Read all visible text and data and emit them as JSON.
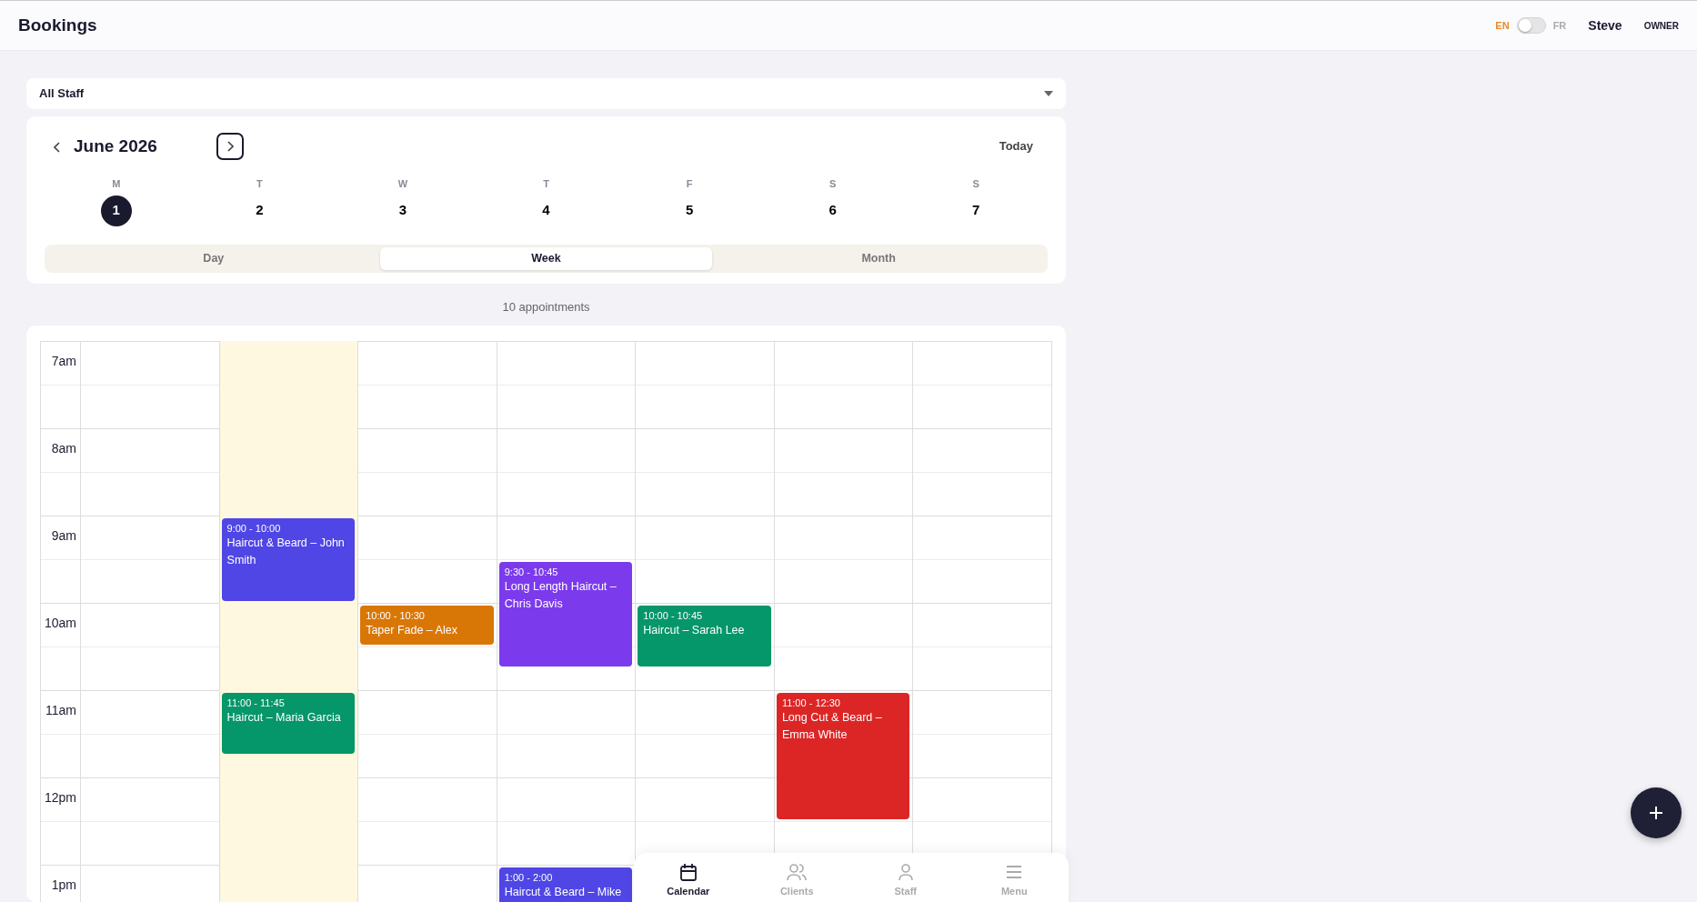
{
  "header": {
    "title": "Bookings",
    "languages": [
      {
        "label": "EN",
        "selected": true
      },
      {
        "label": "FR",
        "selected": false
      }
    ],
    "language_toggle": {
      "on": false
    },
    "user": "Steve",
    "role": "OWNER"
  },
  "staff_filter": {
    "value": "All Staff"
  },
  "calendar": {
    "month": "June 2026",
    "today_button": "Today",
    "days": [
      {
        "weekday": "M",
        "date": "1",
        "selected": true
      },
      {
        "weekday": "T",
        "date": "2",
        "selected": false
      },
      {
        "weekday": "W",
        "date": "3",
        "selected": false
      },
      {
        "weekday": "T",
        "date": "4",
        "selected": false
      },
      {
        "weekday": "F",
        "date": "5",
        "selected": false
      },
      {
        "weekday": "S",
        "date": "6",
        "selected": false
      },
      {
        "weekday": "S",
        "date": "7",
        "selected": false
      }
    ],
    "views": [
      {
        "label": "Day",
        "selected": false
      },
      {
        "label": "Week",
        "selected": true
      },
      {
        "label": "Month",
        "selected": false
      }
    ]
  },
  "appointment_count": "10 appointments",
  "schedule": {
    "hours": [
      "7am",
      "8am",
      "9am",
      "10am",
      "11am",
      "12pm",
      "1pm"
    ],
    "columns": [
      {
        "highlighted": false
      },
      {
        "highlighted": true,
        "events": [
          {
            "time": "9:00 - 10:00",
            "title": "Haircut & Beard – John Smith",
            "color": "#4f46e5"
          },
          {
            "time": "11:00 - 11:45",
            "title": "Haircut – Maria Garcia",
            "color": "#059669"
          }
        ]
      },
      {
        "highlighted": false,
        "events": [
          {
            "time": "10:00 - 10:30",
            "title": "Taper Fade – Alex",
            "color": "#d97706"
          }
        ]
      },
      {
        "highlighted": false,
        "events": [
          {
            "time": "9:30 - 10:45",
            "title": "Long Length Haircut – Chris Davis",
            "color": "#7c3aed"
          },
          {
            "time": "1:00 - 2:00",
            "title": "Haircut & Beard – Mike",
            "color": "#4f46e5"
          }
        ]
      },
      {
        "highlighted": false,
        "events": [
          {
            "time": "10:00 - 10:45",
            "title": "Haircut – Sarah Lee",
            "color": "#059669"
          }
        ]
      },
      {
        "highlighted": false,
        "events": [
          {
            "time": "11:00 - 12:30",
            "title": "Long Cut & Beard – Emma White",
            "color": "#dc2626"
          }
        ]
      },
      {
        "highlighted": false
      }
    ]
  },
  "bottom_nav": [
    {
      "kind": "calendar",
      "label": "Calendar",
      "selected": true
    },
    {
      "kind": "clients",
      "label": "Clients",
      "selected": false
    },
    {
      "kind": "staff",
      "label": "Staff",
      "selected": false
    },
    {
      "kind": "menu",
      "label": "Menu",
      "selected": false
    }
  ]
}
